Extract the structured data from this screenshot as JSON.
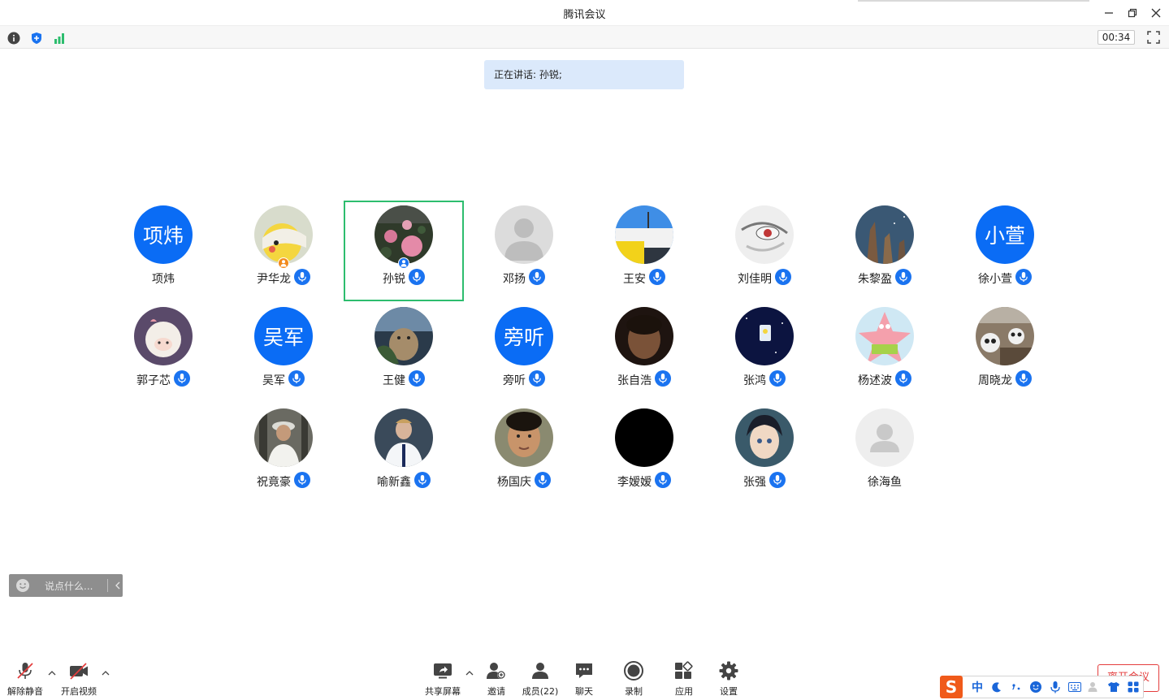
{
  "window": {
    "title": "腾讯会议"
  },
  "status": {
    "timer": "00:34"
  },
  "speaking": {
    "text": "正在讲话: 孙锐;"
  },
  "participants": [
    {
      "name": "项炜",
      "avatar_text": "项炜",
      "mic": false
    },
    {
      "name": "尹华龙",
      "avatar": "pikachu-photo",
      "mic": true,
      "badge": "host"
    },
    {
      "name": "孙锐",
      "avatar": "roses-photo",
      "mic": true,
      "badge": "cohost",
      "speaking": true
    },
    {
      "name": "邓扬",
      "avatar": "default-gray",
      "mic": true
    },
    {
      "name": "王安",
      "avatar": "building-photo",
      "mic": true
    },
    {
      "name": "刘佳明",
      "avatar": "anime-eye-photo",
      "mic": true
    },
    {
      "name": "朱黎盈",
      "avatar": "nebula-photo",
      "mic": true
    },
    {
      "name": "徐小萱",
      "avatar_text": "小萱",
      "mic": true
    },
    {
      "name": "郭子芯",
      "avatar": "sheep-cartoon",
      "mic": true
    },
    {
      "name": "吴军",
      "avatar_text": "吴军",
      "mic": true
    },
    {
      "name": "王健",
      "avatar": "bear-photo",
      "mic": true
    },
    {
      "name": "旁听",
      "avatar_text": "旁听",
      "mic": true
    },
    {
      "name": "张自浩",
      "avatar": "boy-dark-photo",
      "mic": true
    },
    {
      "name": "张鸿",
      "avatar": "night-photo",
      "mic": true
    },
    {
      "name": "杨述波",
      "avatar": "patrick-cartoon",
      "mic": true
    },
    {
      "name": "周晓龙",
      "avatar": "pandas-photo",
      "mic": true
    },
    {
      "name": "祝竟豪",
      "avatar": "man-hat-photo",
      "mic": true
    },
    {
      "name": "喻新鑫",
      "avatar": "soccer-player-photo",
      "mic": true
    },
    {
      "name": "杨国庆",
      "avatar": "boy-photo",
      "mic": true
    },
    {
      "name": "李嫒嫒",
      "avatar": "black",
      "mic": true
    },
    {
      "name": "张强",
      "avatar": "anime-boy-photo",
      "mic": true
    },
    {
      "name": "徐海鱼",
      "avatar": "default-light",
      "mic": false
    }
  ],
  "chat": {
    "placeholder": "说点什么..."
  },
  "toolbar": {
    "unmute": "解除静音",
    "video": "开启视频",
    "share": "共享屏幕",
    "invite": "邀请",
    "members": "成员(22)",
    "chat": "聊天",
    "record": "录制",
    "apps": "应用",
    "settings": "设置",
    "leave": "离开会议"
  },
  "ime": {
    "logo": "S",
    "lang": "中"
  },
  "colors": {
    "accent": "#0a6cf5",
    "active_border": "#2dbd6e",
    "leave": "#e43d3d"
  }
}
